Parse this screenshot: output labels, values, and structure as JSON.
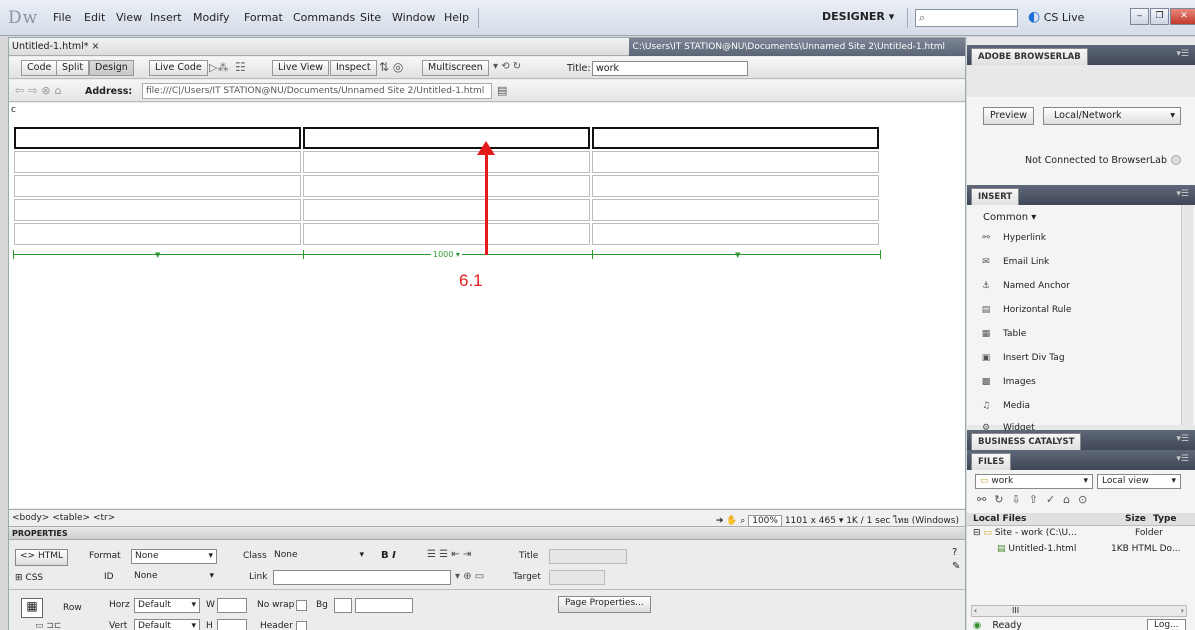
{
  "app": {
    "logo": "Dw",
    "menu": [
      "File",
      "Edit",
      "View",
      "Insert",
      "Modify",
      "Format",
      "Commands",
      "Site",
      "Window",
      "Help"
    ],
    "workspace": "DESIGNER ▾",
    "cslive": "CS Live"
  },
  "document": {
    "tab": "Untitled-1.html* ×",
    "path": "C:\\Users\\IT STATION@NU\\Documents\\Unnamed Site 2\\Untitled-1.html",
    "view_buttons": [
      "Code",
      "Split",
      "Design"
    ],
    "live_code": "Live Code",
    "live_view": "Live View",
    "inspect": "Inspect",
    "multiscreen": "Multiscreen",
    "title_label": "Title:",
    "title_value": "work",
    "address_label": "Address:",
    "address_value": "file:///C|/Users/IT STATION@NU/Documents/Unnamed Site 2/Untitled-1.html",
    "canvas_text": "c",
    "table_width_label": "1000 ▾",
    "annotation": "6.1"
  },
  "status": {
    "tags": "<body> <table> <tr>",
    "zoom": "100%",
    "info": "1101 x 465 ▾  1K / 1 sec  ไทย (Windows)"
  },
  "properties": {
    "header": "PROPERTIES",
    "html": "<> HTML",
    "css": "CSS",
    "format_label": "Format",
    "format_value": "None",
    "class_label": "Class",
    "class_value": "None",
    "id_label": "ID",
    "id_value": "None",
    "link_label": "Link",
    "title_label": "Title",
    "target_label": "Target",
    "row_label": "Row",
    "horz_label": "Horz",
    "horz_value": "Default",
    "vert_label": "Vert",
    "vert_value": "Default",
    "w_label": "W",
    "h_label": "H",
    "nowrap_label": "No wrap",
    "header_label": "Header",
    "bg_label": "Bg",
    "page_props": "Page Properties..."
  },
  "panels": {
    "browserlab": "ADOBE BROWSERLAB",
    "preview": "Preview",
    "local_network": "Local/Network",
    "not_connected": "Not Connected to BrowserLab",
    "insert": "INSERT",
    "insert_category": "Common ▾",
    "insert_items": [
      "Hyperlink",
      "Email Link",
      "Named Anchor",
      "Horizontal Rule",
      "Table",
      "Insert Div Tag",
      "Images",
      "Media",
      "Widget"
    ],
    "business_catalyst": "BUSINESS CATALYST",
    "files": "FILES",
    "site_select": "work",
    "view_select": "Local view",
    "local_files": "Local Files",
    "size_col": "Size",
    "type_col": "Type",
    "site_row": "Site - work (C:\\U...",
    "site_type": "Folder",
    "file_row": "Untitled-1.html",
    "file_info": "1KB HTML Do...",
    "ready": "Ready",
    "log": "Log..."
  }
}
